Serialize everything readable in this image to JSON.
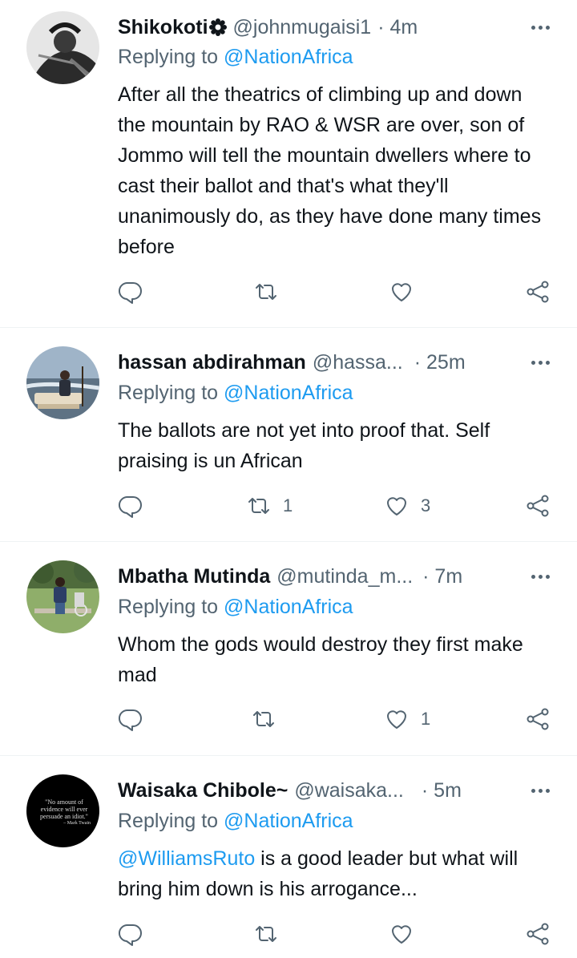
{
  "tweets": [
    {
      "name": "Shikokoti",
      "handle": "@johnmugaisi1",
      "time": "· 4m",
      "replying_prefix": "Replying to",
      "replying_to": "@NationAfrica",
      "mention": "",
      "text": "After all the theatrics of climbing up and down the mountain  by RAO & WSR are over, son of Jommo will tell the mountain dwellers where to cast their ballot and that's what they'll unanimously do, as they have done many times before",
      "retweets": "",
      "likes": ""
    },
    {
      "name": "hassan abdirahman",
      "handle": "@hassa...",
      "time": "· 25m",
      "replying_prefix": "Replying to",
      "replying_to": "@NationAfrica",
      "mention": "",
      "text": "The ballots are not yet into proof that. Self praising is un African",
      "retweets": "1",
      "likes": "3"
    },
    {
      "name": "Mbatha Mutinda",
      "handle": "@mutinda_m...",
      "time": "· 7m",
      "replying_prefix": "Replying to",
      "replying_to": "@NationAfrica",
      "mention": "",
      "text": "Whom the gods would destroy they first make mad",
      "retweets": "",
      "likes": "1"
    },
    {
      "name": "Waisaka Chibole~",
      "handle": "@waisaka...",
      "time": "· 5m",
      "replying_prefix": "Replying to",
      "replying_to": "@NationAfrica",
      "mention": "@WilliamsRuto",
      "text": " is a good leader but what will bring him down is his arrogance...",
      "retweets": "",
      "likes": "",
      "avatar_quote": "\"No amount of evidence will ever persuade an idiot.\"",
      "avatar_attribution": "– Mark Twain"
    }
  ],
  "colors": {
    "link": "#1d9bf0",
    "secondary": "#536471",
    "text": "#0f1419",
    "divider": "#eff3f4"
  }
}
